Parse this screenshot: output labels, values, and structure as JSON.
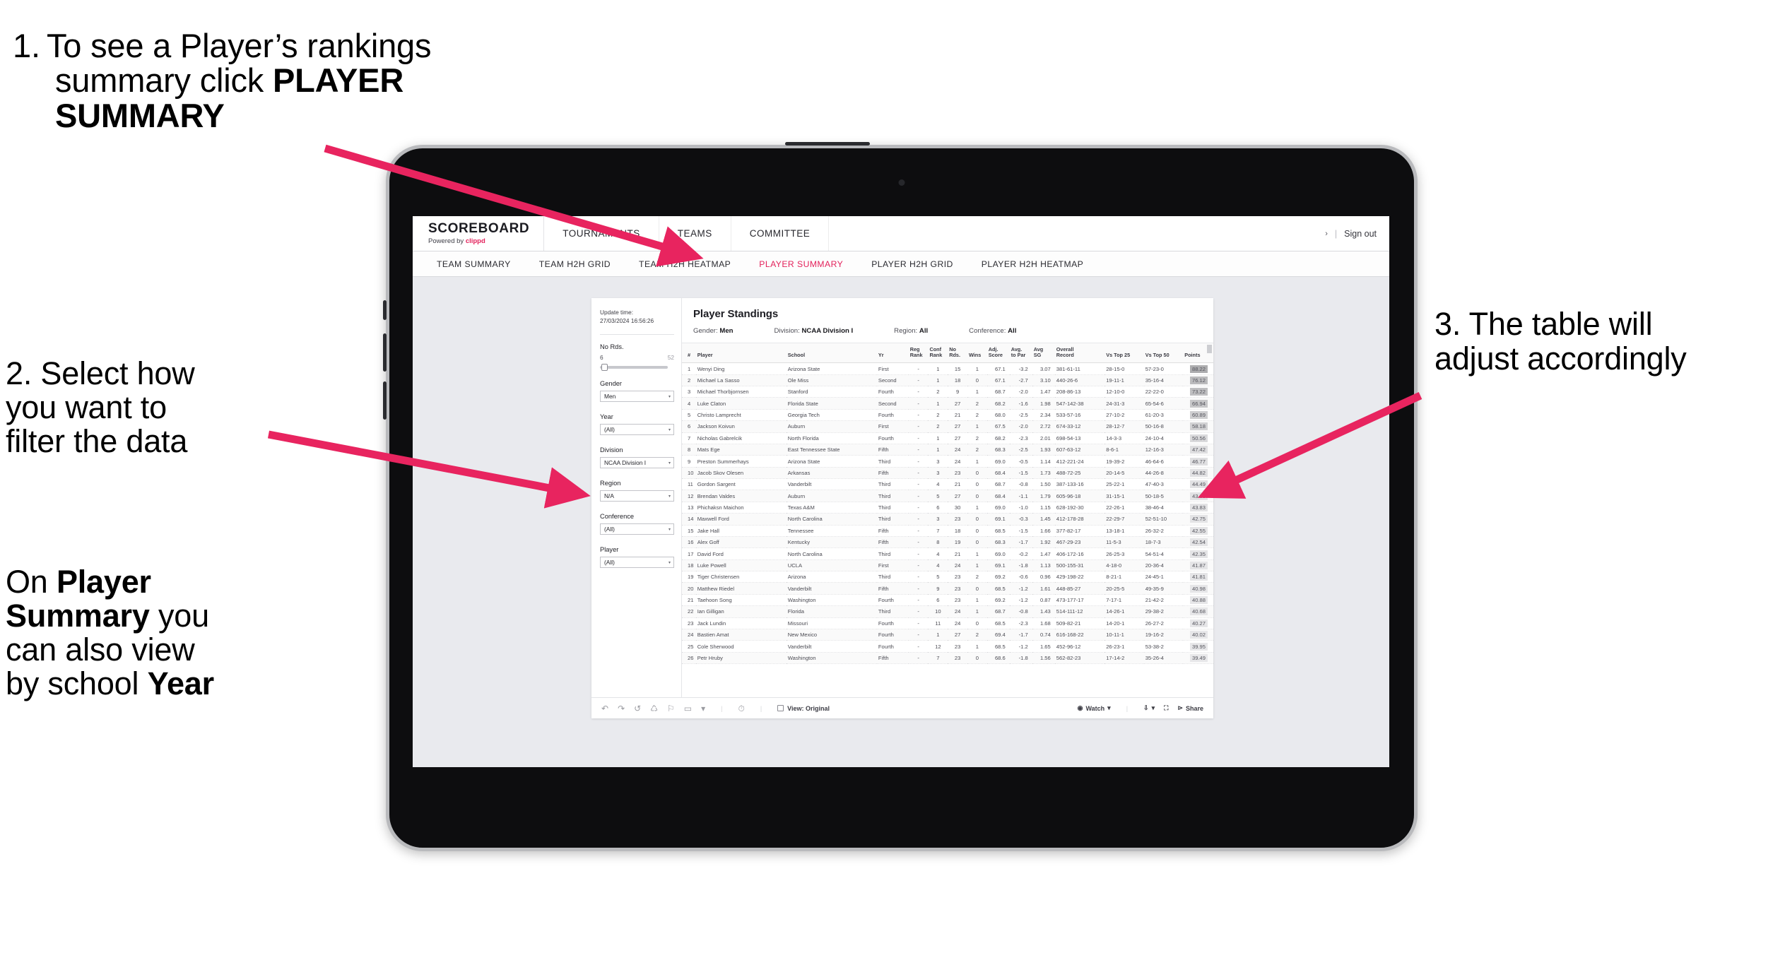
{
  "annotations": {
    "step1": {
      "number": "1.",
      "line1": "To see a Player’s rankings",
      "line2_plain": "summary click ",
      "line2_bold": "PLAYER",
      "line3_bold": "SUMMARY"
    },
    "step2": {
      "line1": "2. Select how",
      "line2": "you want to",
      "line3": "filter the data",
      "p2_l1_plain": "On ",
      "p2_l1_bold": "Player",
      "p2_l2_bold": "Summary",
      "p2_l2_plain": " you",
      "p2_l3": "can also view",
      "p2_l4_plain": "by school ",
      "p2_l4_bold": "Year"
    },
    "step3": {
      "line1": "3. The table will",
      "line2": "adjust accordingly"
    },
    "arrow_color": "#e8245f"
  },
  "app": {
    "brand": {
      "title": "SCOREBOARD",
      "powered_prefix": "Powered by ",
      "powered_brand": "clippd"
    },
    "top_nav": [
      "TOURNAMENTS",
      "TEAMS",
      "COMMITTEE"
    ],
    "header_right": {
      "chevron": "›",
      "divider": "|",
      "sign_out": "Sign out"
    },
    "sub_nav": [
      {
        "label": "TEAM SUMMARY",
        "active": false
      },
      {
        "label": "TEAM H2H GRID",
        "active": false
      },
      {
        "label": "TEAM H2H HEATMAP",
        "active": false
      },
      {
        "label": "PLAYER SUMMARY",
        "active": true
      },
      {
        "label": "PLAYER H2H GRID",
        "active": false
      },
      {
        "label": "PLAYER H2H HEATMAP",
        "active": false
      }
    ],
    "accent_color": "#e3215b"
  },
  "filters": {
    "update_label": "Update time:",
    "update_value": "27/03/2024 16:56:26",
    "slider": {
      "title": "No Rds.",
      "min": "6",
      "max": "52"
    },
    "groups": [
      {
        "title": "Gender",
        "value": "Men"
      },
      {
        "title": "Year",
        "value": "(All)"
      },
      {
        "title": "Division",
        "value": "NCAA Division I"
      },
      {
        "title": "Region",
        "value": "N/A"
      },
      {
        "title": "Conference",
        "value": "(All)"
      },
      {
        "title": "Player",
        "value": "(All)"
      }
    ],
    "caret": "▾"
  },
  "viz": {
    "title": "Player Standings",
    "filter_line": [
      {
        "label": "Gender:",
        "value": "Men"
      },
      {
        "label": "Division:",
        "value": "NCAA Division I"
      },
      {
        "label": "Region:",
        "value": "All"
      },
      {
        "label": "Conference:",
        "value": "All"
      }
    ]
  },
  "toolbar": {
    "icons": [
      "undo-icon",
      "redo-icon",
      "revert-icon",
      "refresh-icon",
      "pause-icon",
      "alerts-icon"
    ],
    "caret": "▾",
    "view_label": "View: Original",
    "watch_label": "Watch",
    "share_label": "Share"
  },
  "chart_data": {
    "type": "table",
    "title": "Player Standings",
    "columns": [
      "#",
      "Player",
      "School",
      "Yr",
      "Reg Rank",
      "Conf Rank",
      "No Rds.",
      "Wins",
      "Adj. Score",
      "Avg. to Par",
      "Avg SG",
      "Overall Record",
      "Vs Top 25",
      "Vs Top 50",
      "Points"
    ],
    "rows": [
      [
        "1",
        "Wenyi Ding",
        "Arizona State",
        "First",
        "-",
        "1",
        "15",
        "1",
        "67.1",
        "-3.2",
        "3.07",
        "381-61-11",
        "28-15-0",
        "57-23-0",
        "88.22"
      ],
      [
        "2",
        "Michael La Sasso",
        "Ole Miss",
        "Second",
        "-",
        "1",
        "18",
        "0",
        "67.1",
        "-2.7",
        "3.10",
        "440-26-6",
        "19-11-1",
        "35-16-4",
        "76.12"
      ],
      [
        "3",
        "Michael Thorbjornsen",
        "Stanford",
        "Fourth",
        "-",
        "2",
        "9",
        "1",
        "68.7",
        "-2.0",
        "1.47",
        "208-86-13",
        "12-10-0",
        "22-22-0",
        "73.22"
      ],
      [
        "4",
        "Luke Claton",
        "Florida State",
        "Second",
        "-",
        "1",
        "27",
        "2",
        "68.2",
        "-1.6",
        "1.98",
        "547-142-38",
        "24-31-3",
        "65-54-6",
        "66.94"
      ],
      [
        "5",
        "Christo Lamprecht",
        "Georgia Tech",
        "Fourth",
        "-",
        "2",
        "21",
        "2",
        "68.0",
        "-2.5",
        "2.34",
        "533-57-16",
        "27-10-2",
        "61-20-3",
        "60.89"
      ],
      [
        "6",
        "Jackson Koivun",
        "Auburn",
        "First",
        "-",
        "2",
        "27",
        "1",
        "67.5",
        "-2.0",
        "2.72",
        "674-33-12",
        "28-12-7",
        "50-16-8",
        "58.18"
      ],
      [
        "7",
        "Nicholas Gabrelcik",
        "North Florida",
        "Fourth",
        "-",
        "1",
        "27",
        "2",
        "68.2",
        "-2.3",
        "2.01",
        "698-54-13",
        "14-3-3",
        "24-10-4",
        "50.56"
      ],
      [
        "8",
        "Mats Ege",
        "East Tennessee State",
        "Fifth",
        "-",
        "1",
        "24",
        "2",
        "68.3",
        "-2.5",
        "1.93",
        "607-63-12",
        "8-6-1",
        "12-16-3",
        "47.42"
      ],
      [
        "9",
        "Preston Summerhays",
        "Arizona State",
        "Third",
        "-",
        "3",
        "24",
        "1",
        "69.0",
        "-0.5",
        "1.14",
        "412-221-24",
        "19-39-2",
        "46-64-6",
        "46.77"
      ],
      [
        "10",
        "Jacob Skov Olesen",
        "Arkansas",
        "Fifth",
        "-",
        "3",
        "23",
        "0",
        "68.4",
        "-1.5",
        "1.73",
        "488-72-25",
        "20-14-5",
        "44-26-8",
        "44.82"
      ],
      [
        "11",
        "Gordon Sargent",
        "Vanderbilt",
        "Third",
        "-",
        "4",
        "21",
        "0",
        "68.7",
        "-0.8",
        "1.50",
        "387-133-16",
        "25-22-1",
        "47-40-3",
        "44.49"
      ],
      [
        "12",
        "Brendan Valdes",
        "Auburn",
        "Third",
        "-",
        "5",
        "27",
        "0",
        "68.4",
        "-1.1",
        "1.79",
        "605-96-18",
        "31-15-1",
        "50-18-5",
        "43.95"
      ],
      [
        "13",
        "Phichaksn Maichon",
        "Texas A&M",
        "Third",
        "-",
        "6",
        "30",
        "1",
        "69.0",
        "-1.0",
        "1.15",
        "628-192-30",
        "22-26-1",
        "38-46-4",
        "43.83"
      ],
      [
        "14",
        "Maxwell Ford",
        "North Carolina",
        "Third",
        "-",
        "3",
        "23",
        "0",
        "69.1",
        "-0.3",
        "1.45",
        "412-178-28",
        "22-29-7",
        "52-51-10",
        "42.75"
      ],
      [
        "15",
        "Jake Hall",
        "Tennessee",
        "Fifth",
        "-",
        "7",
        "18",
        "0",
        "68.5",
        "-1.5",
        "1.66",
        "377-82-17",
        "13-18-1",
        "26-32-2",
        "42.55"
      ],
      [
        "16",
        "Alex Goff",
        "Kentucky",
        "Fifth",
        "-",
        "8",
        "19",
        "0",
        "68.3",
        "-1.7",
        "1.92",
        "467-29-23",
        "11-5-3",
        "18-7-3",
        "42.54"
      ],
      [
        "17",
        "David Ford",
        "North Carolina",
        "Third",
        "-",
        "4",
        "21",
        "1",
        "69.0",
        "-0.2",
        "1.47",
        "406-172-16",
        "26-25-3",
        "54-51-4",
        "42.35"
      ],
      [
        "18",
        "Luke Powell",
        "UCLA",
        "First",
        "-",
        "4",
        "24",
        "1",
        "69.1",
        "-1.8",
        "1.13",
        "500-155-31",
        "4-18-0",
        "20-36-4",
        "41.87"
      ],
      [
        "19",
        "Tiger Christensen",
        "Arizona",
        "Third",
        "-",
        "5",
        "23",
        "2",
        "69.2",
        "-0.6",
        "0.96",
        "429-198-22",
        "8-21-1",
        "24-45-1",
        "41.81"
      ],
      [
        "20",
        "Matthew Riedel",
        "Vanderbilt",
        "Fifth",
        "-",
        "9",
        "23",
        "0",
        "68.5",
        "-1.2",
        "1.61",
        "448-85-27",
        "20-25-5",
        "49-35-9",
        "40.98"
      ],
      [
        "21",
        "Taehoon Song",
        "Washington",
        "Fourth",
        "-",
        "6",
        "23",
        "1",
        "69.2",
        "-1.2",
        "0.87",
        "473-177-17",
        "7-17-1",
        "21-42-2",
        "40.88"
      ],
      [
        "22",
        "Ian Gilligan",
        "Florida",
        "Third",
        "-",
        "10",
        "24",
        "1",
        "68.7",
        "-0.8",
        "1.43",
        "514-111-12",
        "14-26-1",
        "29-38-2",
        "40.68"
      ],
      [
        "23",
        "Jack Lundin",
        "Missouri",
        "Fourth",
        "-",
        "11",
        "24",
        "0",
        "68.5",
        "-2.3",
        "1.68",
        "509-82-21",
        "14-20-1",
        "26-27-2",
        "40.27"
      ],
      [
        "24",
        "Bastien Amat",
        "New Mexico",
        "Fourth",
        "-",
        "1",
        "27",
        "2",
        "69.4",
        "-1.7",
        "0.74",
        "616-168-22",
        "10-11-1",
        "19-16-2",
        "40.02"
      ],
      [
        "25",
        "Cole Sherwood",
        "Vanderbilt",
        "Fourth",
        "-",
        "12",
        "23",
        "1",
        "68.5",
        "-1.2",
        "1.65",
        "452-96-12",
        "26-23-1",
        "53-38-2",
        "39.95"
      ],
      [
        "26",
        "Petr Hruby",
        "Washington",
        "Fifth",
        "-",
        "7",
        "23",
        "0",
        "68.6",
        "-1.8",
        "1.56",
        "562-82-23",
        "17-14-2",
        "35-26-4",
        "39.49"
      ]
    ],
    "header_groups": [
      [
        "#",
        ""
      ],
      [
        "Player",
        ""
      ],
      [
        "School",
        ""
      ],
      [
        "Yr",
        ""
      ],
      [
        "Reg",
        "Rank"
      ],
      [
        "Conf",
        "Rank"
      ],
      [
        "No",
        "Rds."
      ],
      [
        "Wins",
        ""
      ],
      [
        "Adj.",
        "Score"
      ],
      [
        "Avg.",
        "to Par"
      ],
      [
        "Avg",
        "SG"
      ],
      [
        "Overall",
        "Record"
      ],
      [
        "Vs Top 25",
        ""
      ],
      [
        "Vs Top 50",
        ""
      ],
      [
        "Points",
        ""
      ]
    ]
  }
}
